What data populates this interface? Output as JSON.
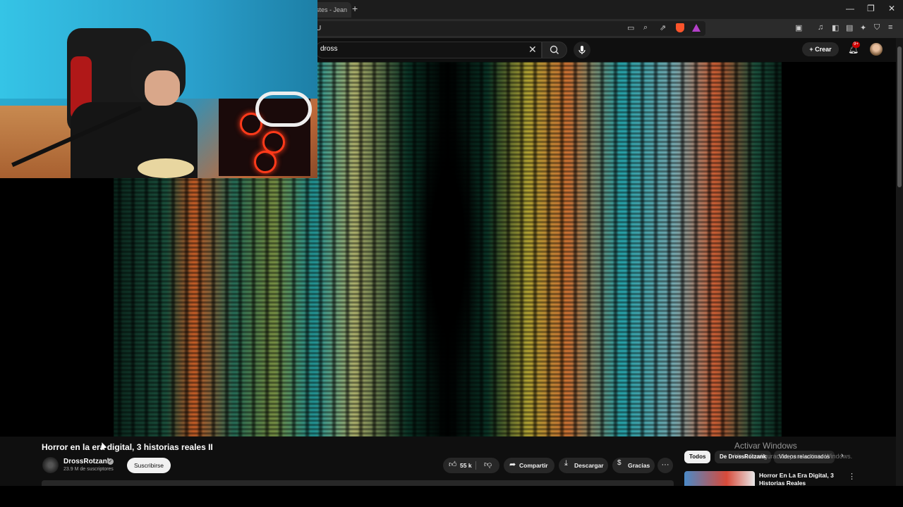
{
  "browser": {
    "tab_title": "stes - Jean",
    "new_tab_symbol": "+",
    "url_fragment": "U",
    "window_controls": {
      "minimize": "—",
      "restore": "❐",
      "close": "✕"
    }
  },
  "header": {
    "search_value": "dross",
    "create_label": "Crear",
    "notifications_badge": "9+"
  },
  "video": {
    "title": "Horror en la era digital, 3 historias reales II",
    "channel_name": "DrossRotzank",
    "subscribers": "23.9 M de suscriptores",
    "subscribe_label": "Suscribirse",
    "likes": "55 k",
    "share_label": "Compartir",
    "download_label": "Descargar",
    "thanks_label": "Gracias",
    "more_symbol": "···"
  },
  "sidebar": {
    "chips": [
      {
        "label": "Todos"
      },
      {
        "label": "De DrossRotzank"
      },
      {
        "label": "Videos relacionados"
      }
    ],
    "recommendations": [
      {
        "title": "Horror En La Era Digital, 3 Historias Reales"
      }
    ]
  },
  "watermark": {
    "line1": "Activar Windows",
    "line2": "Ve a Configuración para activar Windows."
  },
  "colors": {
    "background": "#0f0f0f",
    "brave_shield": "#fb542b",
    "notification": "#cc0000"
  }
}
